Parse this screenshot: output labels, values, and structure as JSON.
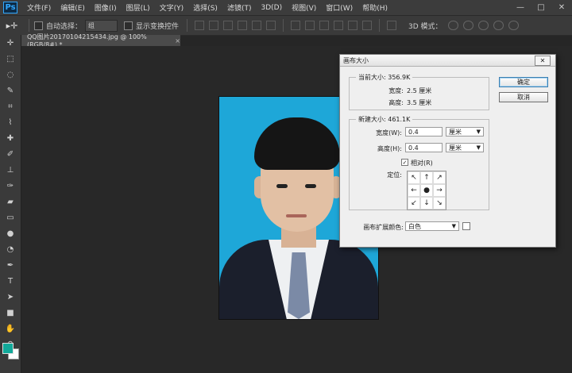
{
  "app": {
    "logo": "Ps"
  },
  "menu": [
    "文件(F)",
    "编辑(E)",
    "图像(I)",
    "图层(L)",
    "文字(Y)",
    "选择(S)",
    "滤镜(T)",
    "3D(D)",
    "视图(V)",
    "窗口(W)",
    "帮助(H)"
  ],
  "window_controls": {
    "minimize": "—",
    "maximize": "□",
    "close": "✕"
  },
  "options_bar": {
    "auto_select_label": "自动选择：",
    "auto_select_value": "组",
    "show_transform_label": "显示变换控件",
    "mode_3d_label": "3D 模式："
  },
  "document": {
    "tab_title": "QQ图片20170104215434.jpg @ 100%(RGB/8#) *",
    "close_glyph": "×"
  },
  "tools": [
    "move-tool",
    "marquee-tool",
    "lasso-tool",
    "quick-select-tool",
    "crop-tool",
    "eyedropper-tool",
    "healing-brush-tool",
    "brush-tool",
    "clone-stamp-tool",
    "history-brush-tool",
    "eraser-tool",
    "gradient-tool",
    "blur-tool",
    "dodge-tool",
    "pen-tool",
    "type-tool",
    "path-select-tool",
    "shape-tool",
    "hand-tool",
    "zoom-tool"
  ],
  "colors": {
    "foreground": "#12a99a",
    "background": "#ffffff",
    "photo_bg": "#1ea7d8"
  },
  "dialog": {
    "title": "画布大小",
    "ok_label": "确定",
    "cancel_label": "取消",
    "current_size": {
      "label": "当前大小: 356.9K",
      "width_label": "宽度:",
      "width_value": "2.5 厘米",
      "height_label": "高度:",
      "height_value": "3.5 厘米"
    },
    "new_size": {
      "label": "新建大小: 461.1K",
      "width_label": "宽度(W):",
      "width_value": "0.4",
      "width_unit": "厘米",
      "height_label": "高度(H):",
      "height_value": "0.4",
      "height_unit": "厘米",
      "relative_label": "相对(R)",
      "relative_checked": true,
      "anchor_label": "定位:",
      "anchor_glyphs": [
        "↖",
        "↑",
        "↗",
        "←",
        "●",
        "→",
        "↙",
        "↓",
        "↘"
      ]
    },
    "extension_color_label": "画布扩展颜色:",
    "extension_color_value": "白色"
  }
}
